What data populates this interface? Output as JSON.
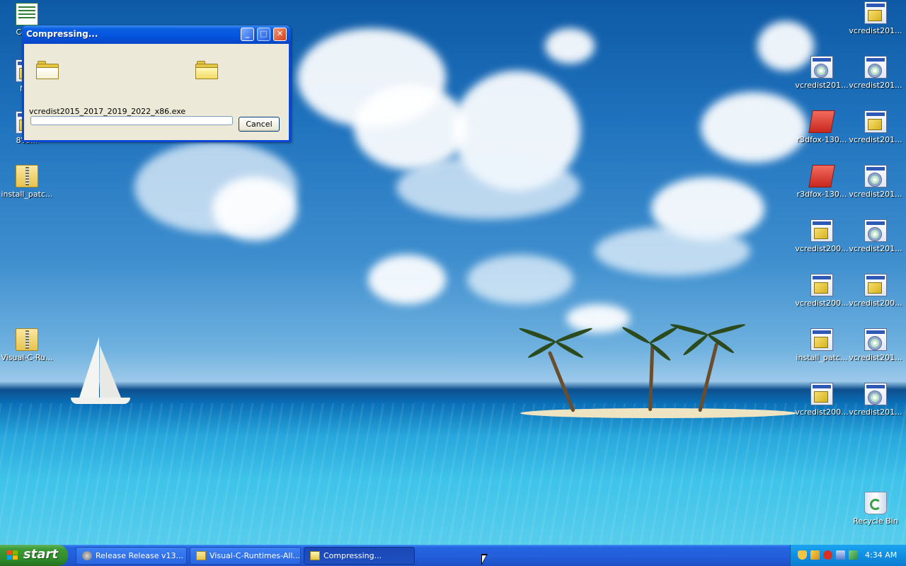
{
  "dialog": {
    "title": "Compressing...",
    "filename": "vcredist2015_2017_2019_2022_x86.exe",
    "cancel_label": "Cancel",
    "progress_fraction": 0.0,
    "buttons": {
      "minimize": "_",
      "maximize": "□",
      "close": "✕"
    }
  },
  "desktop_icons_left": [
    {
      "label": "Coll...",
      "icon": "image-file-icon"
    },
    {
      "label": "M...",
      "icon": "shortcut-icon"
    },
    {
      "label": "8Va...",
      "icon": "file-icon"
    },
    {
      "label": "install_patc...",
      "icon": "zip-folder-icon"
    },
    {
      "label": "Visual-C-Ru...",
      "icon": "zip-folder-icon"
    }
  ],
  "desktop_icons_right": [
    {
      "label": "vcredist201...",
      "icon": "setup-icon"
    },
    {
      "label": "vcredist201...",
      "icon": "setup-disc-icon"
    },
    {
      "label": "vcredist201...",
      "icon": "setup-disc-icon"
    },
    {
      "label": "r3dfox-130...",
      "icon": "r3dfox-icon"
    },
    {
      "label": "vcredist201...",
      "icon": "setup-icon"
    },
    {
      "label": "r3dfox-130...",
      "icon": "r3dfox-icon"
    },
    {
      "label": "vcredist201...",
      "icon": "setup-disc-icon"
    },
    {
      "label": "vcredist200...",
      "icon": "setup-icon"
    },
    {
      "label": "vcredist201...",
      "icon": "setup-disc-icon"
    },
    {
      "label": "vcredist200...",
      "icon": "setup-icon"
    },
    {
      "label": "vcredist200...",
      "icon": "setup-icon"
    },
    {
      "label": "install_patc...",
      "icon": "installer-icon"
    },
    {
      "label": "vcredist201...",
      "icon": "setup-disc-icon"
    },
    {
      "label": "vcredist200...",
      "icon": "setup-icon"
    },
    {
      "label": "vcredist201...",
      "icon": "setup-disc-icon"
    },
    {
      "label": "Recycle Bin",
      "icon": "recycle-bin-icon"
    }
  ],
  "taskbar": {
    "start_label": "start",
    "tasks": [
      {
        "label": "Release Release v13...",
        "icon": "browser-icon"
      },
      {
        "label": "Visual-C-Runtimes-All...",
        "icon": "zip-folder-icon"
      },
      {
        "label": "Compressing...",
        "icon": "folder-icon"
      }
    ],
    "clock": "4:34 AM",
    "tray_icons": [
      "security-shield-icon",
      "network-icon",
      "antivirus-icon",
      "display-icon",
      "network-status-icon"
    ]
  },
  "colors": {
    "titlebar": "#0554dd",
    "taskbar": "#245edb",
    "start": "#3d9b36",
    "dialog_face": "#ece9d8"
  }
}
